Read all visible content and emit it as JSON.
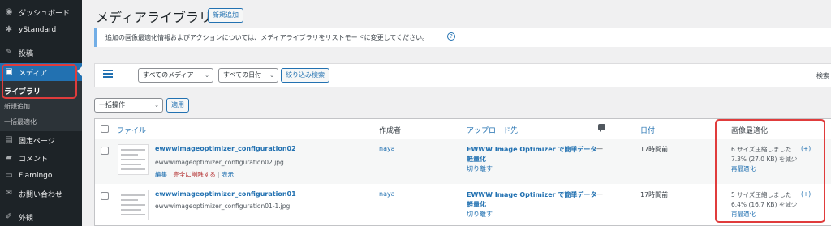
{
  "sidebar": {
    "items": [
      {
        "label": "ダッシュボード",
        "icon": "dashboard-icon"
      },
      {
        "label": "yStandard",
        "icon": "gear-icon"
      },
      {
        "label": "投稿",
        "icon": "pin-icon"
      },
      {
        "label": "メディア",
        "icon": "media-icon"
      },
      {
        "label": "固定ページ",
        "icon": "page-icon"
      },
      {
        "label": "コメント",
        "icon": "comment-icon"
      },
      {
        "label": "Flamingo",
        "icon": "flamingo-icon"
      },
      {
        "label": "お問い合わせ",
        "icon": "mail-icon"
      },
      {
        "label": "外観",
        "icon": "brush-icon"
      }
    ],
    "submenu": [
      "ライブラリ",
      "新規追加",
      "一括最適化"
    ]
  },
  "header": {
    "title": "メディアライブラリ",
    "add_new": "新規追加"
  },
  "notice": {
    "text": "追加の画像最適化情報およびアクションについては、メディアライブラリをリストモードに変更してください。",
    "help": "?"
  },
  "filters": {
    "media_type": "すべてのメディア",
    "date": "すべての日付",
    "filter_button": "絞り込み検索",
    "search_label": "検索"
  },
  "bulk": {
    "action": "一括操作",
    "apply": "適用"
  },
  "table": {
    "columns": {
      "file": "ファイル",
      "author": "作成者",
      "uploaded_to": "アップロード先",
      "date": "日付",
      "optimization": "画像最適化"
    },
    "rows": [
      {
        "title": "ewwwimageoptimizer_configuration02",
        "filename": "ewwwimageoptimizer_configuration02.jpg",
        "actions": {
          "edit": "編集",
          "delete": "完全に削除する",
          "view": "表示"
        },
        "author": "naya",
        "uploaded_to_line1": "EWWW Image Optimizer で簡単データ",
        "uploaded_to_line2": "軽量化",
        "detach": "切り離す",
        "comments": "—",
        "date": "17時間前",
        "opt_line1": "6 サイズ圧縮しました",
        "opt_plus": "(+)",
        "opt_line2": "7.3% (27.0 KB) を減少",
        "opt_reoptimize": "再最適化"
      },
      {
        "title": "ewwwimageoptimizer_configuration01",
        "filename": "ewwwimageoptimizer_configuration01-1.jpg",
        "actions": {
          "edit": "",
          "delete": "",
          "view": ""
        },
        "author": "naya",
        "uploaded_to_line1": "EWWW Image Optimizer で簡単データ",
        "uploaded_to_line2": "軽量化",
        "detach": "切り離す",
        "comments": "—",
        "date": "17時間前",
        "opt_line1": "5 サイズ圧縮しました",
        "opt_plus": "(+)",
        "opt_line2": "6.4% (16.7 KB) を減少",
        "opt_reoptimize": "再最適化"
      }
    ]
  },
  "colors": {
    "accent": "#2271b1",
    "sidebar_bg": "#1d2327",
    "highlight_box": "#e03c3c",
    "delete": "#b32d2e"
  }
}
